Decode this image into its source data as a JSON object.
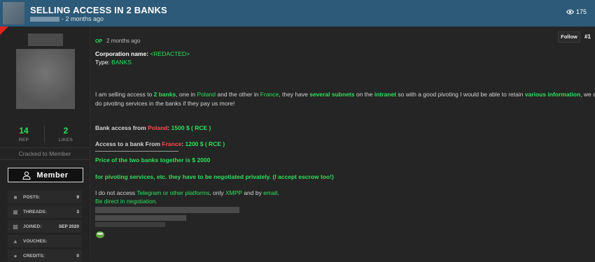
{
  "thread": {
    "title": "SELLING ACCESS IN 2 BANKS",
    "time": "- 2 months ago",
    "views": "175"
  },
  "sidebar": {
    "rep_value": "14",
    "rep_label": "REP",
    "likes_value": "2",
    "likes_label": "LIKES",
    "rank": "Cracked to Member",
    "badge": "Member",
    "stats": [
      {
        "icon": "comments-icon",
        "label": "POSTS:",
        "value": "9"
      },
      {
        "icon": "threads-icon",
        "label": "THREADS:",
        "value": "3"
      },
      {
        "icon": "calendar-icon",
        "label": "JOINED:",
        "value": "SEP 2020"
      },
      {
        "icon": "thumbs-up-icon",
        "label": "VOUCHES:",
        "value": ""
      },
      {
        "icon": "credits-icon",
        "label": "CREDITS:",
        "value": "0"
      }
    ]
  },
  "post": {
    "op_badge": "OP",
    "time": "2 months ago",
    "follow": "Follow",
    "number": "#1",
    "corp_label": "Corporation name: ",
    "corp_value": "<REDACTED>",
    "type_label": "Type: ",
    "type_value": "BANKS",
    "p1": [
      "I am selling access to ",
      "2 banks",
      ", one in ",
      "Poland",
      " and the other in ",
      "France",
      ", they have ",
      "several subnets",
      " on the ",
      "intranet",
      " so with a good pivoting I would be able to retain ",
      "various information",
      ", we also"
    ],
    "p1b": "do pivoting services in the banks if they pay us more!",
    "poland_line": [
      "Bank access from ",
      "Poland",
      ": ",
      "1500 $ ( RCE )"
    ],
    "france_line": [
      "Access to a bank From ",
      "France",
      ": ",
      "1200 $ ( RCE )"
    ],
    "price_line": "Price of the two banks together is $ 2000",
    "pivot_line": "for pivoting services, etc. they have to be negotiated privately. (I accept escrow too!)",
    "contact": [
      "I do not access ",
      "Telegram or other platforms",
      ", only ",
      "XMPP",
      " and by ",
      "email",
      "."
    ],
    "direct": "Be direct in negotiation."
  },
  "colors": {
    "header_bg": "#2c5a78",
    "accent_green": "#2fe05c",
    "accent_red": "#ff4b4b",
    "page_bg": "#252525"
  }
}
